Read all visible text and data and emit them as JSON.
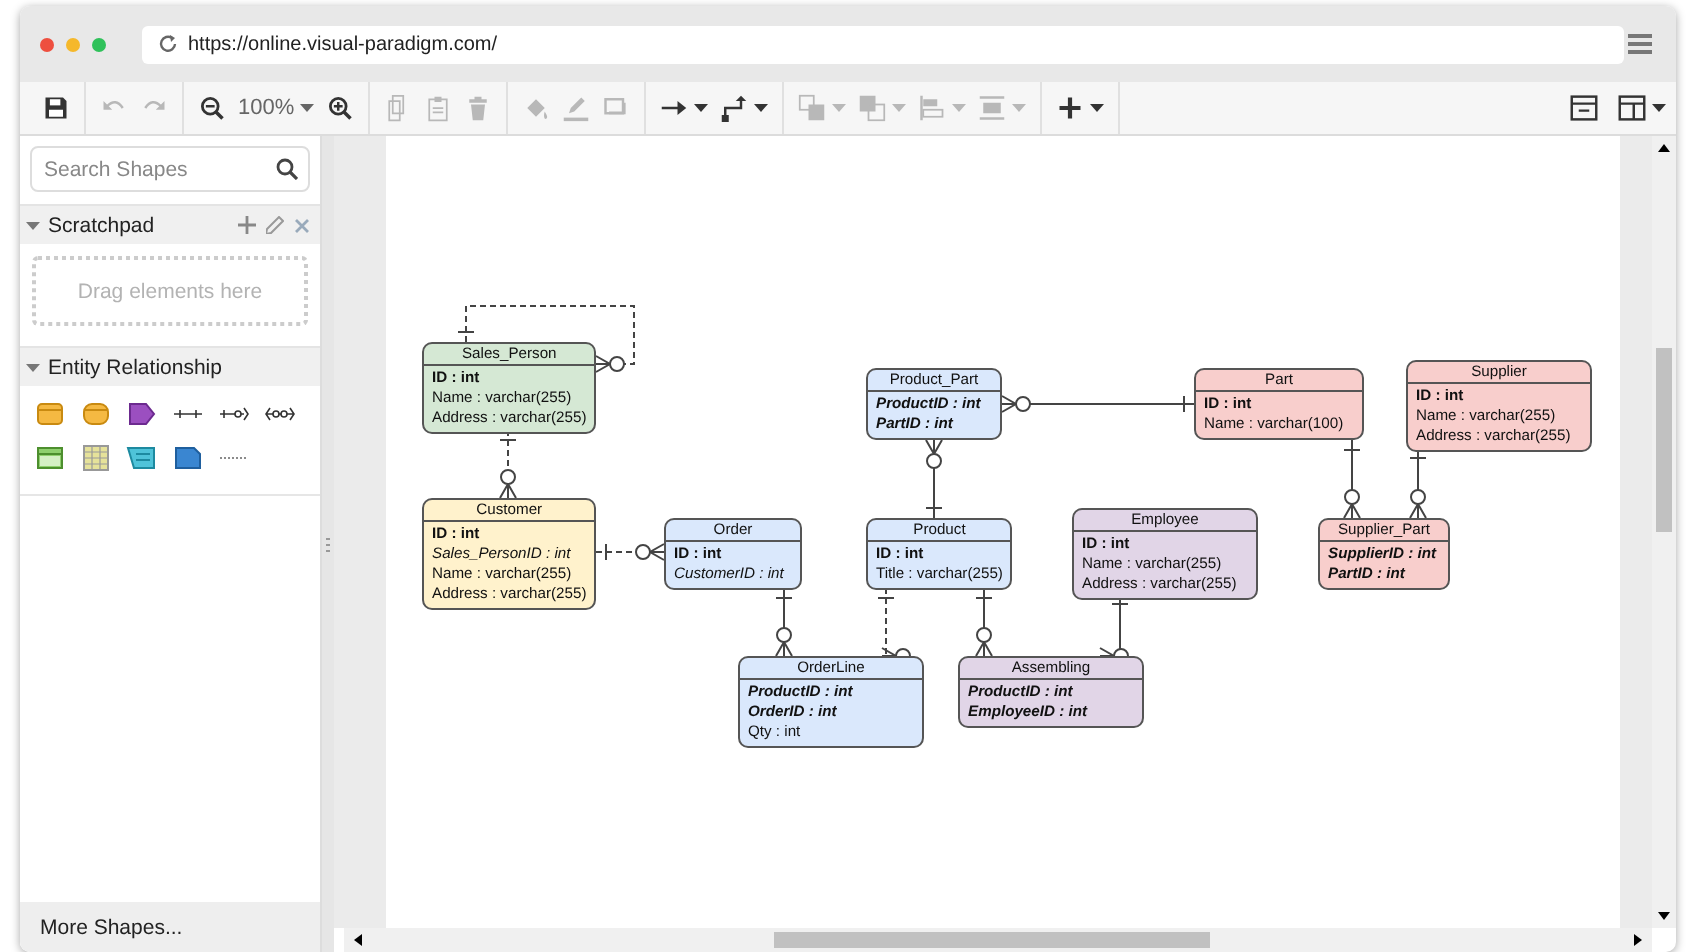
{
  "browser": {
    "url": "https://online.visual-paradigm.com/"
  },
  "toolbar": {
    "groups": [
      [
        {
          "kind": "save",
          "disabled": false
        }
      ],
      [
        {
          "kind": "undo",
          "disabled": true
        },
        {
          "kind": "redo",
          "disabled": true
        }
      ],
      [
        {
          "kind": "zoom_out",
          "disabled": false
        },
        {
          "kind": "zoom_level",
          "label": "100%"
        },
        {
          "kind": "zoom_in",
          "disabled": false
        }
      ],
      [
        {
          "kind": "copy",
          "disabled": true
        },
        {
          "kind": "paste",
          "disabled": true
        },
        {
          "kind": "delete",
          "disabled": true
        }
      ],
      [
        {
          "kind": "fill",
          "disabled": true
        },
        {
          "kind": "line_color",
          "disabled": true
        },
        {
          "kind": "shadow",
          "disabled": true
        }
      ],
      [
        {
          "kind": "connection",
          "disabled": false
        },
        {
          "kind": "waypoints",
          "disabled": false
        }
      ],
      [
        {
          "kind": "to_front",
          "disabled": true
        },
        {
          "kind": "to_back",
          "disabled": true
        },
        {
          "kind": "align",
          "disabled": true
        },
        {
          "kind": "distribute",
          "disabled": true
        }
      ],
      [
        {
          "kind": "insert",
          "disabled": false
        }
      ]
    ],
    "right": [
      {
        "kind": "format",
        "disabled": false
      },
      {
        "kind": "layout",
        "disabled": false
      }
    ]
  },
  "sidebar": {
    "search": {
      "placeholder": "Search Shapes"
    },
    "sections": [
      {
        "title": "Scratchpad",
        "expanded": true,
        "drop_hint": "Drag elements here"
      },
      {
        "title": "Entity Relationship",
        "expanded": true
      }
    ],
    "more_shapes": "More Shapes..."
  },
  "diagram": {
    "entities": [
      {
        "name": "Sales_Person",
        "color": "#d5e8d4",
        "attributes": [
          {
            "text": "ID : int",
            "kind": "pk"
          },
          {
            "text": "Name : varchar(255)",
            "kind": "plain"
          },
          {
            "text": "Address : varchar(255)",
            "kind": "plain"
          }
        ]
      },
      {
        "name": "Product_Part",
        "color": "#dae8fc",
        "attributes": [
          {
            "text": "ProductID : int",
            "kind": "pkfk"
          },
          {
            "text": "PartID : int",
            "kind": "pkfk"
          }
        ]
      },
      {
        "name": "Part",
        "color": "#f8cecc",
        "attributes": [
          {
            "text": "ID : int",
            "kind": "pk"
          },
          {
            "text": "Name : varchar(100)",
            "kind": "plain"
          }
        ]
      },
      {
        "name": "Supplier",
        "color": "#f8cecc",
        "attributes": [
          {
            "text": "ID : int",
            "kind": "pk"
          },
          {
            "text": "Name : varchar(255)",
            "kind": "plain"
          },
          {
            "text": "Address : varchar(255)",
            "kind": "plain"
          }
        ]
      },
      {
        "name": "Customer",
        "color": "#fff2cc",
        "attributes": [
          {
            "text": "ID : int",
            "kind": "pk"
          },
          {
            "text": "Sales_PersonID : int",
            "kind": "fk"
          },
          {
            "text": "Name : varchar(255)",
            "kind": "plain"
          },
          {
            "text": "Address : varchar(255)",
            "kind": "plain"
          }
        ]
      },
      {
        "name": "Order",
        "color": "#dae8fc",
        "attributes": [
          {
            "text": "ID : int",
            "kind": "pk"
          },
          {
            "text": "CustomerID : int",
            "kind": "fk"
          }
        ]
      },
      {
        "name": "Product",
        "color": "#dae8fc",
        "attributes": [
          {
            "text": "ID : int",
            "kind": "pk"
          },
          {
            "text": "Title : varchar(255)",
            "kind": "plain"
          }
        ]
      },
      {
        "name": "Employee",
        "color": "#e1d5e7",
        "attributes": [
          {
            "text": "ID : int",
            "kind": "pk"
          },
          {
            "text": "Name : varchar(255)",
            "kind": "plain"
          },
          {
            "text": "Address : varchar(255)",
            "kind": "plain"
          }
        ]
      },
      {
        "name": "Supplier_Part",
        "color": "#f8cecc",
        "attributes": [
          {
            "text": "SupplierID : int",
            "kind": "pkfk"
          },
          {
            "text": "PartID : int",
            "kind": "pkfk"
          }
        ]
      },
      {
        "name": "OrderLine",
        "color": "#dae8fc",
        "attributes": [
          {
            "text": "ProductID : int",
            "kind": "pkfk"
          },
          {
            "text": "OrderID : int",
            "kind": "pkfk"
          },
          {
            "text": "Qty : int",
            "kind": "plain"
          }
        ]
      },
      {
        "name": "Assembling",
        "color": "#e1d5e7",
        "attributes": [
          {
            "text": "ProductID : int",
            "kind": "pkfk"
          },
          {
            "text": "EmployeeID : int",
            "kind": "pkfk"
          }
        ]
      }
    ],
    "relationships": [
      {
        "dashed": true
      },
      {
        "dashed": true
      },
      {
        "dashed": true
      },
      {
        "dashed": false
      },
      {
        "dashed": false
      },
      {
        "dashed": false
      },
      {
        "dashed": true
      },
      {
        "dashed": false
      },
      {
        "dashed": false
      },
      {
        "dashed": false
      },
      {
        "dashed": false
      }
    ]
  }
}
